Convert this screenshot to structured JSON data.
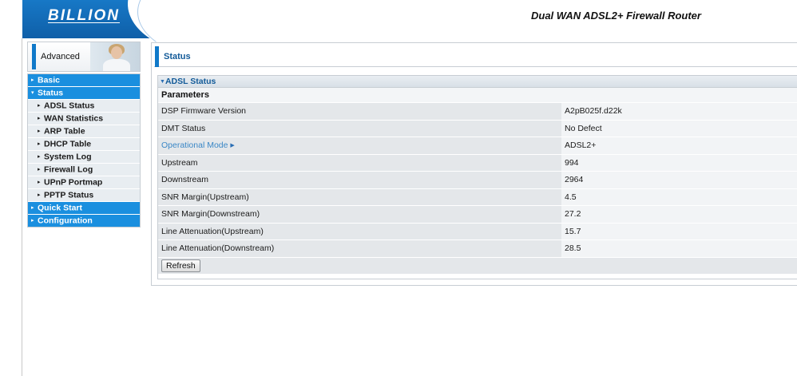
{
  "header": {
    "logo": "BILLION",
    "product_title": "Dual WAN ADSL2+ Firewall Router"
  },
  "advanced": {
    "label": "Advanced"
  },
  "menu": {
    "basic": "Basic",
    "status": "Status",
    "status_items": [
      "ADSL Status",
      "WAN Statistics",
      "ARP Table",
      "DHCP Table",
      "System Log",
      "Firewall Log",
      "UPnP Portmap",
      "PPTP Status"
    ],
    "quick_start": "Quick Start",
    "configuration": "Configuration"
  },
  "page": {
    "title": "Status",
    "section_title": "ADSL Status",
    "params_header": "Parameters",
    "rows": [
      {
        "label": "DSP Firmware Version",
        "value": "A2pB025f.d22k"
      },
      {
        "label": "DMT Status",
        "value": "No Defect"
      },
      {
        "label": "Operational Mode",
        "value": "ADSL2+"
      },
      {
        "label": "Upstream",
        "value": "994"
      },
      {
        "label": "Downstream",
        "value": "2964"
      },
      {
        "label": "SNR Margin(Upstream)",
        "value": "4.5"
      },
      {
        "label": "SNR Margin(Downstream)",
        "value": "27.2"
      },
      {
        "label": "Line Attenuation(Upstream)",
        "value": "15.7"
      },
      {
        "label": "Line Attenuation(Downstream)",
        "value": "28.5"
      }
    ],
    "refresh_label": "Refresh"
  },
  "icons": {
    "menu_collapsed": "triangle-right-icon",
    "menu_expanded": "triangle-down-icon",
    "submenu_bullet": "bullet-arrow-icon"
  },
  "colors": {
    "brand_blue": "#1079c9",
    "menu_blue": "#1a8fdf",
    "title_text": "#125a98",
    "link_text": "#3a87c6"
  }
}
